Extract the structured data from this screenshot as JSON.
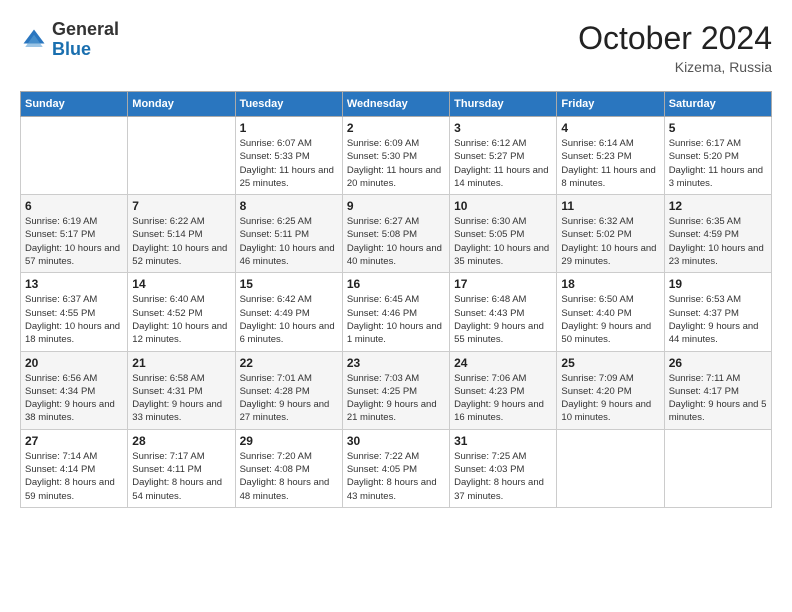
{
  "header": {
    "logo_general": "General",
    "logo_blue": "Blue",
    "month": "October 2024",
    "location": "Kizema, Russia"
  },
  "weekdays": [
    "Sunday",
    "Monday",
    "Tuesday",
    "Wednesday",
    "Thursday",
    "Friday",
    "Saturday"
  ],
  "weeks": [
    [
      {
        "day": "",
        "info": ""
      },
      {
        "day": "",
        "info": ""
      },
      {
        "day": "1",
        "info": "Sunrise: 6:07 AM\nSunset: 5:33 PM\nDaylight: 11 hours and 25 minutes."
      },
      {
        "day": "2",
        "info": "Sunrise: 6:09 AM\nSunset: 5:30 PM\nDaylight: 11 hours and 20 minutes."
      },
      {
        "day": "3",
        "info": "Sunrise: 6:12 AM\nSunset: 5:27 PM\nDaylight: 11 hours and 14 minutes."
      },
      {
        "day": "4",
        "info": "Sunrise: 6:14 AM\nSunset: 5:23 PM\nDaylight: 11 hours and 8 minutes."
      },
      {
        "day": "5",
        "info": "Sunrise: 6:17 AM\nSunset: 5:20 PM\nDaylight: 11 hours and 3 minutes."
      }
    ],
    [
      {
        "day": "6",
        "info": "Sunrise: 6:19 AM\nSunset: 5:17 PM\nDaylight: 10 hours and 57 minutes."
      },
      {
        "day": "7",
        "info": "Sunrise: 6:22 AM\nSunset: 5:14 PM\nDaylight: 10 hours and 52 minutes."
      },
      {
        "day": "8",
        "info": "Sunrise: 6:25 AM\nSunset: 5:11 PM\nDaylight: 10 hours and 46 minutes."
      },
      {
        "day": "9",
        "info": "Sunrise: 6:27 AM\nSunset: 5:08 PM\nDaylight: 10 hours and 40 minutes."
      },
      {
        "day": "10",
        "info": "Sunrise: 6:30 AM\nSunset: 5:05 PM\nDaylight: 10 hours and 35 minutes."
      },
      {
        "day": "11",
        "info": "Sunrise: 6:32 AM\nSunset: 5:02 PM\nDaylight: 10 hours and 29 minutes."
      },
      {
        "day": "12",
        "info": "Sunrise: 6:35 AM\nSunset: 4:59 PM\nDaylight: 10 hours and 23 minutes."
      }
    ],
    [
      {
        "day": "13",
        "info": "Sunrise: 6:37 AM\nSunset: 4:55 PM\nDaylight: 10 hours and 18 minutes."
      },
      {
        "day": "14",
        "info": "Sunrise: 6:40 AM\nSunset: 4:52 PM\nDaylight: 10 hours and 12 minutes."
      },
      {
        "day": "15",
        "info": "Sunrise: 6:42 AM\nSunset: 4:49 PM\nDaylight: 10 hours and 6 minutes."
      },
      {
        "day": "16",
        "info": "Sunrise: 6:45 AM\nSunset: 4:46 PM\nDaylight: 10 hours and 1 minute."
      },
      {
        "day": "17",
        "info": "Sunrise: 6:48 AM\nSunset: 4:43 PM\nDaylight: 9 hours and 55 minutes."
      },
      {
        "day": "18",
        "info": "Sunrise: 6:50 AM\nSunset: 4:40 PM\nDaylight: 9 hours and 50 minutes."
      },
      {
        "day": "19",
        "info": "Sunrise: 6:53 AM\nSunset: 4:37 PM\nDaylight: 9 hours and 44 minutes."
      }
    ],
    [
      {
        "day": "20",
        "info": "Sunrise: 6:56 AM\nSunset: 4:34 PM\nDaylight: 9 hours and 38 minutes."
      },
      {
        "day": "21",
        "info": "Sunrise: 6:58 AM\nSunset: 4:31 PM\nDaylight: 9 hours and 33 minutes."
      },
      {
        "day": "22",
        "info": "Sunrise: 7:01 AM\nSunset: 4:28 PM\nDaylight: 9 hours and 27 minutes."
      },
      {
        "day": "23",
        "info": "Sunrise: 7:03 AM\nSunset: 4:25 PM\nDaylight: 9 hours and 21 minutes."
      },
      {
        "day": "24",
        "info": "Sunrise: 7:06 AM\nSunset: 4:23 PM\nDaylight: 9 hours and 16 minutes."
      },
      {
        "day": "25",
        "info": "Sunrise: 7:09 AM\nSunset: 4:20 PM\nDaylight: 9 hours and 10 minutes."
      },
      {
        "day": "26",
        "info": "Sunrise: 7:11 AM\nSunset: 4:17 PM\nDaylight: 9 hours and 5 minutes."
      }
    ],
    [
      {
        "day": "27",
        "info": "Sunrise: 7:14 AM\nSunset: 4:14 PM\nDaylight: 8 hours and 59 minutes."
      },
      {
        "day": "28",
        "info": "Sunrise: 7:17 AM\nSunset: 4:11 PM\nDaylight: 8 hours and 54 minutes."
      },
      {
        "day": "29",
        "info": "Sunrise: 7:20 AM\nSunset: 4:08 PM\nDaylight: 8 hours and 48 minutes."
      },
      {
        "day": "30",
        "info": "Sunrise: 7:22 AM\nSunset: 4:05 PM\nDaylight: 8 hours and 43 minutes."
      },
      {
        "day": "31",
        "info": "Sunrise: 7:25 AM\nSunset: 4:03 PM\nDaylight: 8 hours and 37 minutes."
      },
      {
        "day": "",
        "info": ""
      },
      {
        "day": "",
        "info": ""
      }
    ]
  ]
}
